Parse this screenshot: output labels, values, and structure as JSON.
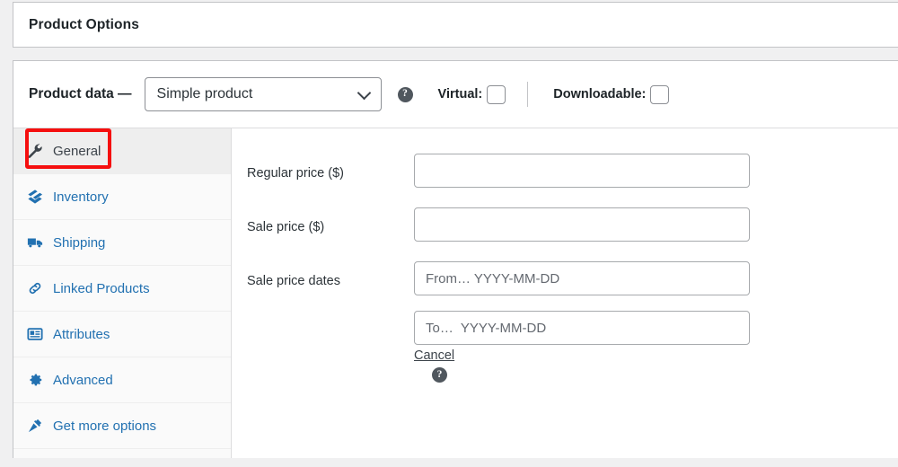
{
  "panel_options": {
    "title": "Product Options"
  },
  "product_data": {
    "label": "Product data —",
    "type_select": {
      "value": "Simple product",
      "icon": "chevron-down-icon"
    },
    "help_icon": "?",
    "virtual": {
      "label": "Virtual:",
      "checked": false
    },
    "downloadable": {
      "label": "Downloadable:",
      "checked": false
    }
  },
  "tabs": [
    {
      "label": "General",
      "icon": "wrench-icon",
      "active": true
    },
    {
      "label": "Inventory",
      "icon": "box-icon",
      "active": false
    },
    {
      "label": "Shipping",
      "icon": "truck-icon",
      "active": false
    },
    {
      "label": "Linked Products",
      "icon": "link-icon",
      "active": false
    },
    {
      "label": "Attributes",
      "icon": "list-icon",
      "active": false
    },
    {
      "label": "Advanced",
      "icon": "gear-icon",
      "active": false
    },
    {
      "label": "Get more options",
      "icon": "plugin-icon",
      "active": false
    }
  ],
  "general_fields": {
    "regular_price": {
      "label": "Regular price ($)",
      "value": "",
      "placeholder": ""
    },
    "sale_price": {
      "label": "Sale price ($)",
      "value": "",
      "placeholder": ""
    },
    "sale_dates": {
      "label": "Sale price dates",
      "from_placeholder": "From… YYYY-MM-DD",
      "from_value": "",
      "to_placeholder": "To…  YYYY-MM-DD",
      "to_value": "",
      "cancel_label": "Cancel",
      "help_icon": "?"
    }
  },
  "annotation": {
    "highlight_target": "General",
    "color": "#f50f0f"
  },
  "colors": {
    "page_background": "#f0f0f1",
    "panel_background": "#ffffff",
    "panel_border": "#c3c4c7",
    "link_blue": "#2271b1",
    "tab_active_background": "#eeeeee",
    "tabs_background": "#fafafa",
    "text_dark": "#1d2327",
    "highlight_red": "#f50f0f"
  }
}
